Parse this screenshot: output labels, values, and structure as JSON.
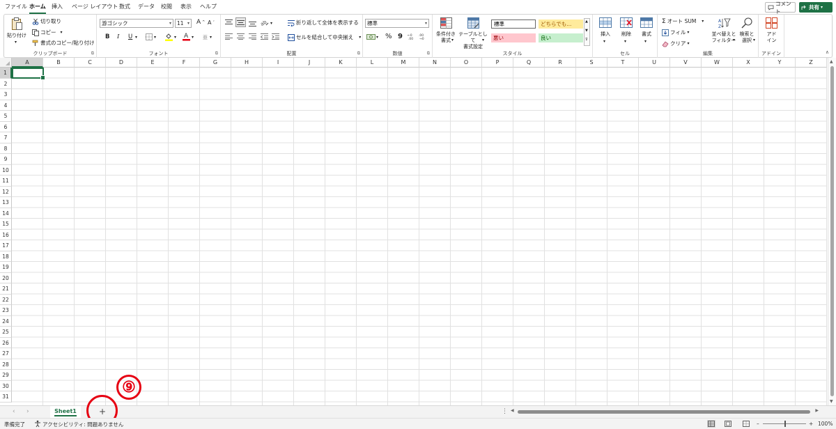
{
  "menu": {
    "tabs": [
      {
        "label": "ファイル",
        "active": false
      },
      {
        "label": "ホーム",
        "active": true
      },
      {
        "label": "挿入",
        "active": false
      },
      {
        "label": "ページ レイアウト",
        "active": false
      },
      {
        "label": "数式",
        "active": false
      },
      {
        "label": "データ",
        "active": false
      },
      {
        "label": "校閲",
        "active": false
      },
      {
        "label": "表示",
        "active": false
      },
      {
        "label": "ヘルプ",
        "active": false
      }
    ],
    "comment_label": "コメント",
    "share_label": "共有"
  },
  "ribbon": {
    "clipboard": {
      "paste_label": "貼り付け",
      "cut_label": "切り取り",
      "copy_label": "コピー",
      "format_painter_label": "書式のコピー/貼り付け",
      "group_label": "クリップボード"
    },
    "font": {
      "font_name": "游ゴシック",
      "font_size": "11",
      "bold": "B",
      "italic": "I",
      "underline": "U",
      "group_label": "フォント"
    },
    "alignment": {
      "wrap_text_label": "折り返して全体を表示する",
      "merge_center_label": "セルを結合して中央揃え",
      "group_label": "配置"
    },
    "number": {
      "format_value": "標準",
      "percent": "%",
      "comma": "9",
      "group_label": "数値"
    },
    "styles": {
      "conditional_format_label": "条件付き\n書式",
      "format_as_table_label": "テーブルとして\n書式設定",
      "cell_styles": [
        {
          "label": "標準",
          "bg": "#ffffff",
          "fg": "#000000"
        },
        {
          "label": "どちらでも...",
          "bg": "#ffeb9c",
          "fg": "#9c5700"
        },
        {
          "label": "悪い",
          "bg": "#ffc7ce",
          "fg": "#9c0006"
        },
        {
          "label": "良い",
          "bg": "#c6efce",
          "fg": "#006100"
        }
      ],
      "group_label": "スタイル"
    },
    "cells": {
      "insert_label": "挿入",
      "delete_label": "削除",
      "format_label": "書式",
      "group_label": "セル"
    },
    "editing": {
      "autosum_label": "オート SUM",
      "fill_label": "フィル",
      "clear_label": "クリア",
      "sort_filter_label": "並べ替えと\nフィルター",
      "find_select_label": "検索と\n選択",
      "group_label": "編集"
    },
    "addins": {
      "addins_label": "アド\nイン",
      "group_label": "アドイン"
    }
  },
  "grid": {
    "columns": [
      "A",
      "B",
      "C",
      "D",
      "E",
      "F",
      "G",
      "H",
      "I",
      "J",
      "K",
      "L",
      "M",
      "N",
      "O",
      "P",
      "Q",
      "R",
      "S",
      "T",
      "U",
      "V",
      "W",
      "X",
      "Y",
      "Z"
    ],
    "rows": [
      "1",
      "2",
      "3",
      "4",
      "5",
      "6",
      "7",
      "8",
      "9",
      "10",
      "11",
      "12",
      "13",
      "14",
      "15",
      "16",
      "17",
      "18",
      "19",
      "20",
      "21",
      "22",
      "23",
      "24",
      "25",
      "26",
      "27",
      "28",
      "29",
      "30",
      "31"
    ],
    "active_cell": "A1"
  },
  "sheets": {
    "tabs": [
      "Sheet1"
    ],
    "add_label": "+"
  },
  "annotation": {
    "number": "⑨",
    "color": "#e60012"
  },
  "status": {
    "ready": "準備完了",
    "accessibility": "アクセシビリティ: 問題ありません",
    "zoom": "100%"
  },
  "colors": {
    "accent": "#1e7145"
  }
}
